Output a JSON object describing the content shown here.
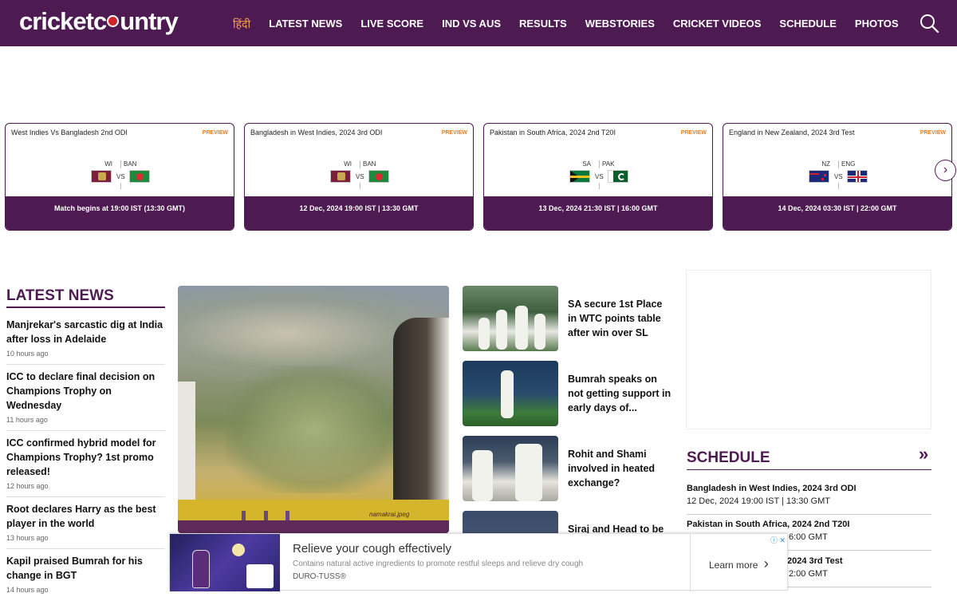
{
  "header": {
    "logo_left": "cricketc",
    "logo_right": "untry",
    "nav": [
      "हिंदी",
      "LATEST NEWS",
      "LIVE SCORE",
      "IND VS AUS",
      "RESULTS",
      "WEBSTORIES",
      "CRICKET VIDEOS",
      "SCHEDULE",
      "PHOTOS"
    ]
  },
  "match_cards": [
    {
      "title": "West Indies Vs Bangladesh 2nd ODI",
      "badge": "PREVIEW",
      "team1": "WI",
      "team2": "BAN",
      "vs": "VS",
      "footer": "Match begins at 19:00 IST (13:30 GMT)"
    },
    {
      "title": "Bangladesh in West Indies, 2024 3rd ODI",
      "badge": "PREVIEW",
      "team1": "WI",
      "team2": "BAN",
      "vs": "VS",
      "footer": "12 Dec, 2024 19:00 IST | 13:30 GMT"
    },
    {
      "title": "Pakistan in South Africa, 2024 2nd T20I",
      "badge": "PREVIEW",
      "team1": "SA",
      "team2": "PAK",
      "vs": "VS",
      "footer": "13 Dec, 2024 21:30 IST | 16:00 GMT"
    },
    {
      "title": "England in New Zealand, 2024 3rd Test",
      "badge": "PREVIEW",
      "team1": "NZ",
      "team2": "ENG",
      "vs": "VS",
      "footer": "14 Dec, 2024 03:30 IST | 22:00 GMT"
    }
  ],
  "cards_next": "›",
  "latest": {
    "title": "LATEST NEWS",
    "items": [
      {
        "headline": "Manjrekar's sarcastic dig at India after loss in Adelaide",
        "time": "10 hours ago"
      },
      {
        "headline": "ICC to declare final decision on Champions Trophy on Wednesday",
        "time": "11 hours ago"
      },
      {
        "headline": "ICC confirmed hybrid model for Champions Trophy? 1st promo released!",
        "time": "12 hours ago"
      },
      {
        "headline": "Root declares Harry as the best player in the world",
        "time": "13 hours ago"
      },
      {
        "headline": "Kapil praised Bumrah for his change in BGT",
        "time": "14 hours ago"
      }
    ]
  },
  "hero": {
    "caption": "namakrai.jpeg"
  },
  "side_news": [
    {
      "headline": "SA secure 1st Place in WTC points table after win over SL"
    },
    {
      "headline": "Bumrah speaks on not getting support in early days of..."
    },
    {
      "headline": "Rohit and Shami involved in heated exchange?"
    },
    {
      "headline": "Siraj and Head to be"
    }
  ],
  "schedule": {
    "title": "SCHEDULE",
    "arrow": "»",
    "items": [
      {
        "name": "Bangladesh in West Indies, 2024 3rd ODI",
        "time": "12 Dec, 2024 19:00 IST | 13:30 GMT"
      },
      {
        "name": "Pakistan in South Africa, 2024 2nd T20I",
        "time": "6:00 GMT"
      },
      {
        "name": "2024 3rd Test",
        "time": "2:00 GMT"
      }
    ]
  },
  "ad": {
    "headline": "Relieve your cough effectively",
    "sub": "Contains natural active ingredients to promote restful sleeps and relieve dry cough",
    "brand": "DURO-TUSS®",
    "cta": "Learn more",
    "cta_arrow": "›",
    "info": "ⓘ ✕"
  }
}
